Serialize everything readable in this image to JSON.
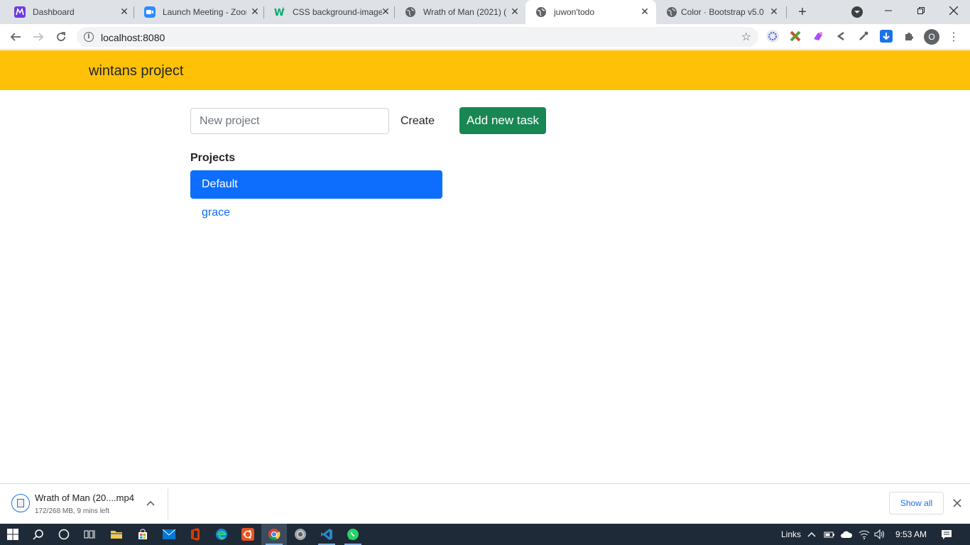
{
  "browser": {
    "tabs": [
      {
        "title": "Dashboard",
        "favicon": "mural-logo-icon",
        "color": "#6b3cdb"
      },
      {
        "title": "Launch Meeting - Zoom",
        "favicon": "zoom-logo-icon",
        "color": "#2d8cff"
      },
      {
        "title": "CSS background-image",
        "favicon": "w3schools-logo-icon",
        "color": "#04aa6d"
      },
      {
        "title": "Wrath of Man (2021) (",
        "favicon": "globe-icon",
        "color": "#5f6368"
      },
      {
        "title": "juwon'todo",
        "favicon": "globe-icon",
        "color": "#5f6368",
        "active": true
      },
      {
        "title": "Color · Bootstrap v5.0",
        "favicon": "globe-icon",
        "color": "#5f6368"
      }
    ],
    "new_tab": "+",
    "address": "localhost:8080",
    "profile_initial": "O",
    "extensions": [
      "cluster-extension-icon",
      "puzzle-x-extension-icon",
      "magic-extension-icon",
      "arrow-extension-icon",
      "eyedropper-extension-icon",
      "download-extension-icon",
      "extensions-puzzle-icon"
    ]
  },
  "app": {
    "brand": "wintans project",
    "new_project_placeholder": "New project",
    "create_label": "Create",
    "add_task_label": "Add new task",
    "projects_heading": "Projects",
    "projects": [
      {
        "name": "Default",
        "active": true
      },
      {
        "name": "grace",
        "active": false
      }
    ]
  },
  "downloads": {
    "file_name": "Wrath of Man (20....mp4",
    "status": "172/268 MB, 9 mins left",
    "show_all": "Show all"
  },
  "taskbar": {
    "apps": [
      "search-icon",
      "cortana-icon",
      "task-view-icon",
      "file-explorer-icon",
      "store-icon",
      "mail-icon",
      "office-icon",
      "edge-icon",
      "ubuntu-icon",
      "chrome-icon",
      "chrome-canary-icon",
      "vscode-icon",
      "whatsapp-icon"
    ],
    "links_label": "Links",
    "time": "9:53 AM"
  },
  "colors": {
    "navbar": "#ffc107",
    "primary": "#0d6efd",
    "success": "#198754"
  }
}
